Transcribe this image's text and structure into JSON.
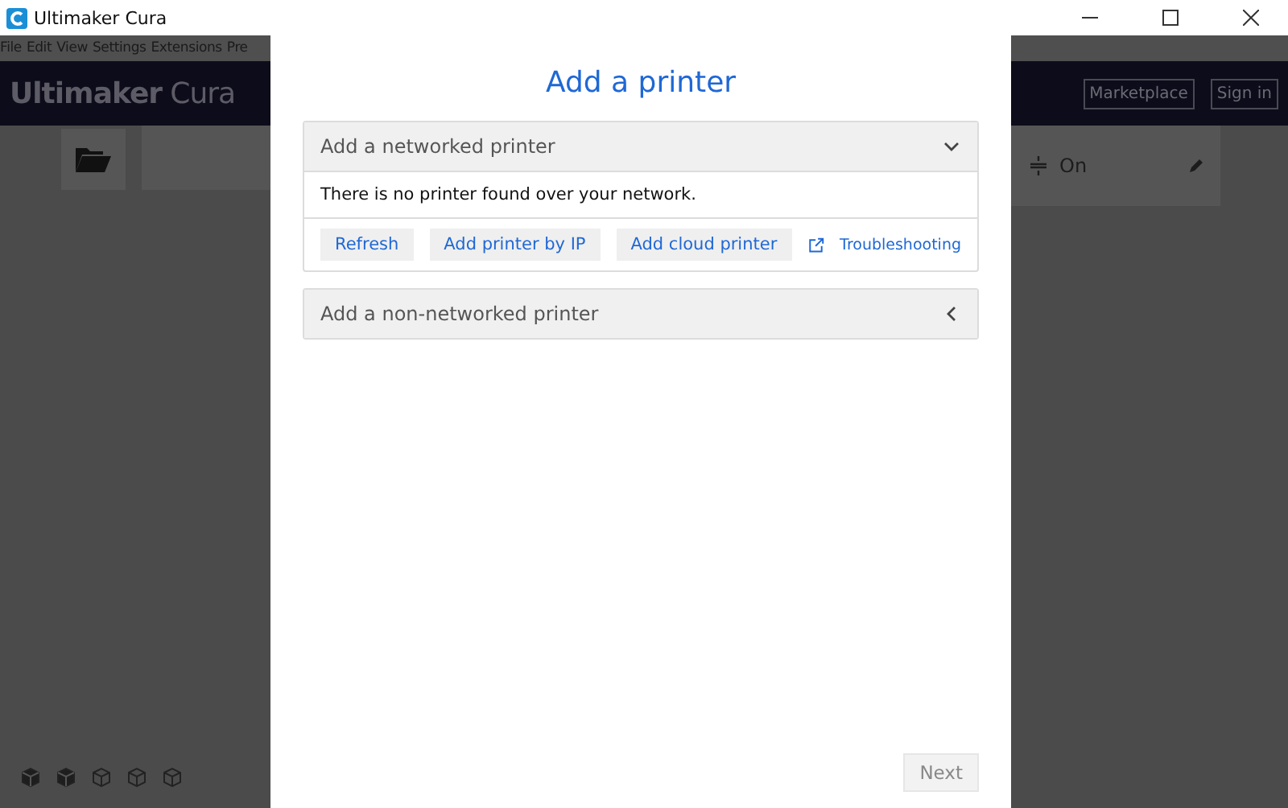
{
  "window": {
    "title": "Ultimaker Cura"
  },
  "menu": [
    "File",
    "Edit",
    "View",
    "Settings",
    "Extensions",
    "Pre"
  ],
  "app_header": {
    "logo_bold": "Ultimaker",
    "logo_light": "Cura",
    "buttons": [
      "Marketplace",
      "Sign in"
    ]
  },
  "print_setup": {
    "support": "On"
  },
  "dialog": {
    "title": "Add a printer",
    "sections": [
      {
        "title": "Add a networked printer",
        "expanded": true,
        "message": "There is no printer found over your network.",
        "buttons": [
          "Refresh",
          "Add printer by IP",
          "Add cloud printer"
        ],
        "link": "Troubleshooting"
      },
      {
        "title": "Add a non-networked printer",
        "expanded": false
      }
    ],
    "next": {
      "label": "Next",
      "disabled": true
    }
  }
}
